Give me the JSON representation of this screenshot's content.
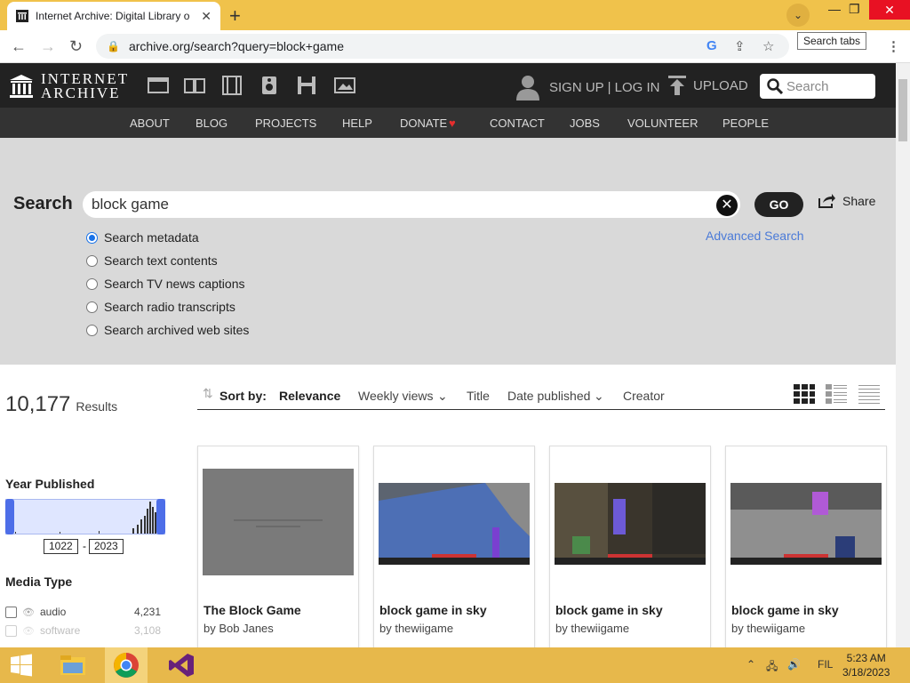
{
  "browser": {
    "tab_title": "Internet Archive: Digital Library o",
    "url": "archive.org/search?query=block+game",
    "tooltip": "Search tabs"
  },
  "ia": {
    "logo_line1": "INTERNET",
    "logo_line2": "ARCHIVE",
    "signin": "SIGN UP | LOG IN",
    "upload": "UPLOAD",
    "search_placeholder": "Search",
    "nav": [
      "ABOUT",
      "BLOG",
      "PROJECTS",
      "HELP",
      "DONATE",
      "CONTACT",
      "JOBS",
      "VOLUNTEER",
      "PEOPLE"
    ]
  },
  "search": {
    "label": "Search",
    "query": "block game",
    "go": "GO",
    "share": "Share",
    "advanced": "Advanced Search",
    "options": [
      "Search metadata",
      "Search text contents",
      "Search TV news captions",
      "Search radio transcripts",
      "Search archived web sites"
    ],
    "selected_index": 0
  },
  "sidebar": {
    "results_count": "10,177",
    "results_label": "Results",
    "year_heading": "Year Published",
    "year_from": "1022",
    "year_to": "2023",
    "media_heading": "Media Type",
    "facets": [
      {
        "label": "audio",
        "count": "4,231"
      },
      {
        "label": "software",
        "count": "3,108"
      }
    ]
  },
  "sort": {
    "label": "Sort by:",
    "options": [
      "Relevance",
      "Weekly views",
      "Title",
      "Date published",
      "Creator"
    ]
  },
  "tiles": [
    {
      "title": "The Block Game",
      "by": "by Bob Janes"
    },
    {
      "title": "block game in sky",
      "by": "by thewiigame"
    },
    {
      "title": "block game in sky",
      "by": "by thewiigame"
    },
    {
      "title": "block game in sky",
      "by": "by thewiigame"
    }
  ],
  "taskbar": {
    "lang": "FIL",
    "time": "5:23 AM",
    "date": "3/18/2023"
  }
}
